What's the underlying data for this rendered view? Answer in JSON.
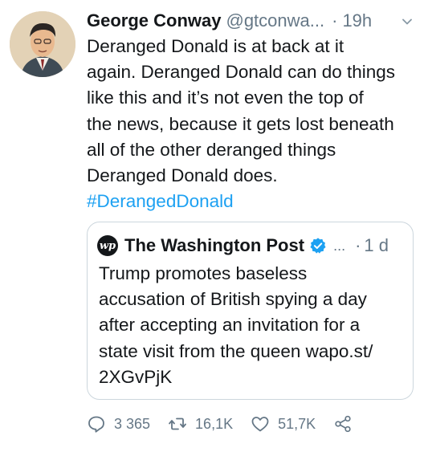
{
  "tweet": {
    "author_name": "George Conway",
    "handle": "@gtconwa...",
    "separator": "·",
    "time": "19h",
    "body_lines": [
      "Deranged Donald is at back at it",
      "again. Deranged Donald can do things",
      "like this and it’s not even the top of",
      "the news, because it gets lost beneath",
      "all of the other deranged things",
      "Deranged Donald does."
    ],
    "hashtag": "#DerangedDonald"
  },
  "quote": {
    "logo_text": "wp",
    "author_name": "The Washington Post",
    "ellipsis": "...",
    "separator": "·",
    "time": "1 d",
    "lines": [
      "Trump promotes baseless",
      "accusation of British spying a day",
      "after accepting an invitation for a",
      "state visit from the queen wapo.st/",
      "2XGvPjK"
    ]
  },
  "actions": {
    "reply_count": "3 365",
    "retweet_count": "16,1K",
    "like_count": "51,7K"
  },
  "icons": {
    "avatar": "avatar-icon",
    "chevron": "chevron-down-icon",
    "verified": "verified-badge-icon",
    "reply": "reply-icon",
    "retweet": "retweet-icon",
    "like": "heart-icon",
    "share": "share-icon"
  },
  "colors": {
    "link": "#1da1f2",
    "muted": "#657786",
    "text": "#14171a",
    "border": "#ccd6dd"
  }
}
